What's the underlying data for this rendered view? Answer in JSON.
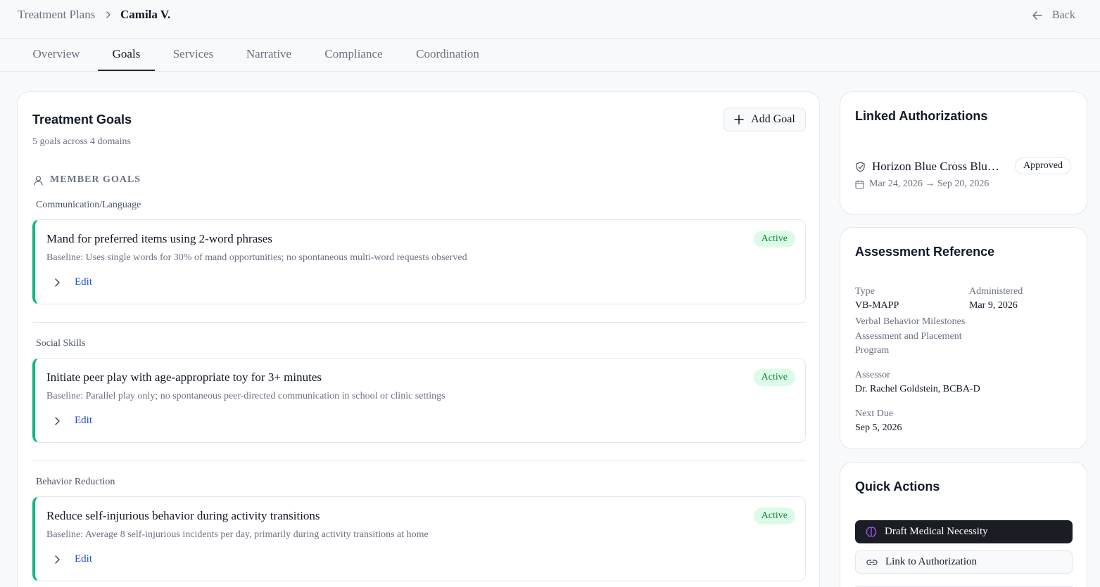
{
  "breadcrumb": {
    "parent": "Treatment Plans",
    "current": "Camila V."
  },
  "header": {
    "back_label": "Back"
  },
  "tabs": [
    {
      "label": "Overview"
    },
    {
      "label": "Goals"
    },
    {
      "label": "Services"
    },
    {
      "label": "Narrative"
    },
    {
      "label": "Compliance"
    },
    {
      "label": "Coordination"
    }
  ],
  "active_tab": "Goals",
  "goals_card": {
    "title": "Treatment Goals",
    "subtitle": "5 goals across 4 domains",
    "add_label": "Add Goal",
    "section_label": "MEMBER GOALS",
    "groups": [
      {
        "domain": "Communication/Language",
        "title": "Mand for preferred items using 2-word phrases",
        "baseline": "Baseline: Uses single words for 30% of mand opportunities; no spontaneous multi-word requests observed",
        "status": "Active",
        "edit_label": "Edit"
      },
      {
        "domain": "Social Skills",
        "title": "Initiate peer play with age-appropriate toy for 3+ minutes",
        "baseline": "Baseline: Parallel play only; no spontaneous peer-directed communication in school or clinic settings",
        "status": "Active",
        "edit_label": "Edit"
      },
      {
        "domain": "Behavior Reduction",
        "title": "Reduce self-injurious behavior during activity transitions",
        "baseline": "Baseline: Average 8 self-injurious incidents per day, primarily during activity transitions at home",
        "status": "Active",
        "edit_label": "Edit"
      }
    ]
  },
  "authorizations": {
    "title": "Linked Authorizations",
    "item": {
      "name": "Horizon Blue Cross Blue Shield",
      "status": "Approved",
      "dates": "Mar 24, 2026 → Sep 20, 2026"
    }
  },
  "assessment": {
    "title": "Assessment Reference",
    "type_label": "Type",
    "type_value": "VB-MAPP",
    "type_desc": "Verbal Behavior Milestones Assessment and Placement Program",
    "administered_label": "Administered",
    "administered_value": "Mar 9, 2026",
    "assessor_label": "Assessor",
    "assessor_value": "Dr. Rachel Goldstein, BCBA-D",
    "next_due_label": "Next Due",
    "next_due_value": "Sep 5, 2026"
  },
  "quick_actions": {
    "title": "Quick Actions",
    "draft_label": "Draft Medical Necessity",
    "link_label": "Link to Authorization"
  },
  "colors": {
    "goal_accent": "#10b981",
    "active_badge_bg": "#dcfce7",
    "active_badge_text": "#15803d",
    "link": "#1d4ed8",
    "dark_button": "#1a1d23",
    "brain_icon": "#a855f7"
  }
}
